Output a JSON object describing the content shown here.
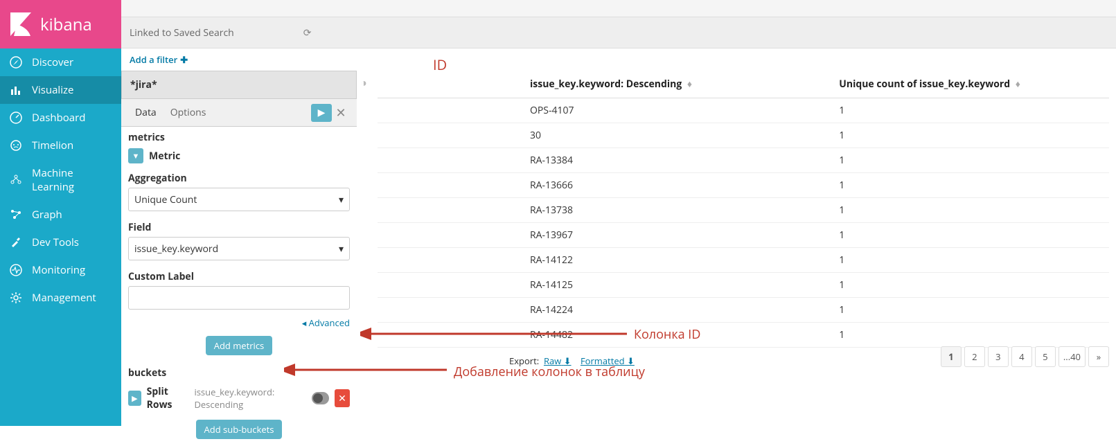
{
  "app": {
    "name": "kibana"
  },
  "sidebar": {
    "items": [
      {
        "label": "Discover"
      },
      {
        "label": "Visualize"
      },
      {
        "label": "Dashboard"
      },
      {
        "label": "Timelion"
      },
      {
        "label": "Machine Learning"
      },
      {
        "label": "Graph"
      },
      {
        "label": "Dev Tools"
      },
      {
        "label": "Monitoring"
      },
      {
        "label": "Management"
      }
    ]
  },
  "header": {
    "linked_search": "Linked to Saved Search",
    "add_filter": "Add a filter"
  },
  "panel": {
    "index_pattern": "*jira*",
    "tabs": {
      "data": "Data",
      "options": "Options"
    },
    "metrics_label": "metrics",
    "metric_title": "Metric",
    "aggregation_label": "Aggregation",
    "aggregation_value": "Unique Count",
    "field_label": "Field",
    "field_value": "issue_key.keyword",
    "custom_label": "Custom Label",
    "custom_label_value": "",
    "advanced": "Advanced",
    "add_metrics": "Add metrics",
    "buckets_label": "buckets",
    "split_rows": "Split Rows",
    "split_rows_sub": "issue_key.keyword: Descending",
    "add_sub_buckets": "Add sub-buckets"
  },
  "table": {
    "col1_header": "issue_key.keyword: Descending",
    "col2_header": "Unique count of issue_key.keyword",
    "rows": [
      {
        "key": "OPS-4107",
        "count": "1"
      },
      {
        "key": "30",
        "count": "1"
      },
      {
        "key": "RA-13384",
        "count": "1"
      },
      {
        "key": "RA-13666",
        "count": "1"
      },
      {
        "key": "RA-13738",
        "count": "1"
      },
      {
        "key": "RA-13967",
        "count": "1"
      },
      {
        "key": "RA-14122",
        "count": "1"
      },
      {
        "key": "RA-14125",
        "count": "1"
      },
      {
        "key": "RA-14224",
        "count": "1"
      },
      {
        "key": "RA-14482",
        "count": "1"
      }
    ],
    "export_label": "Export:",
    "export_raw": "Raw",
    "export_formatted": "Formatted"
  },
  "pagination": {
    "pages": [
      "1",
      "2",
      "3",
      "4",
      "5",
      "...40",
      "»"
    ]
  },
  "annotations": {
    "id": "ID",
    "column_id": "Колонка ID",
    "add_columns": "Добавление колонок в таблицу"
  }
}
